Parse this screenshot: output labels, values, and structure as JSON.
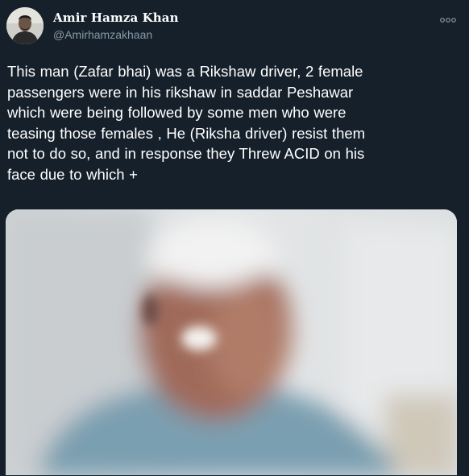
{
  "author": {
    "display_name": "Amir Hamza Khan",
    "handle": "@Amirhamzakhaan"
  },
  "tweet": {
    "text_lines": [
      "This man (Zafar bhai) was a Rikshaw driver, 2 female",
      "passengers were in his rikshaw in saddar Peshawar",
      "which were being followed by some men who were",
      "teasing those females , He (Riksha driver) resist them",
      "not to do so, and in response they Threw ACID on his",
      "face due to which +"
    ]
  },
  "icons": {
    "more": "more-options-icon"
  },
  "colors": {
    "background": "#15202b",
    "text": "#ffffff",
    "handle": "#8899a6"
  }
}
